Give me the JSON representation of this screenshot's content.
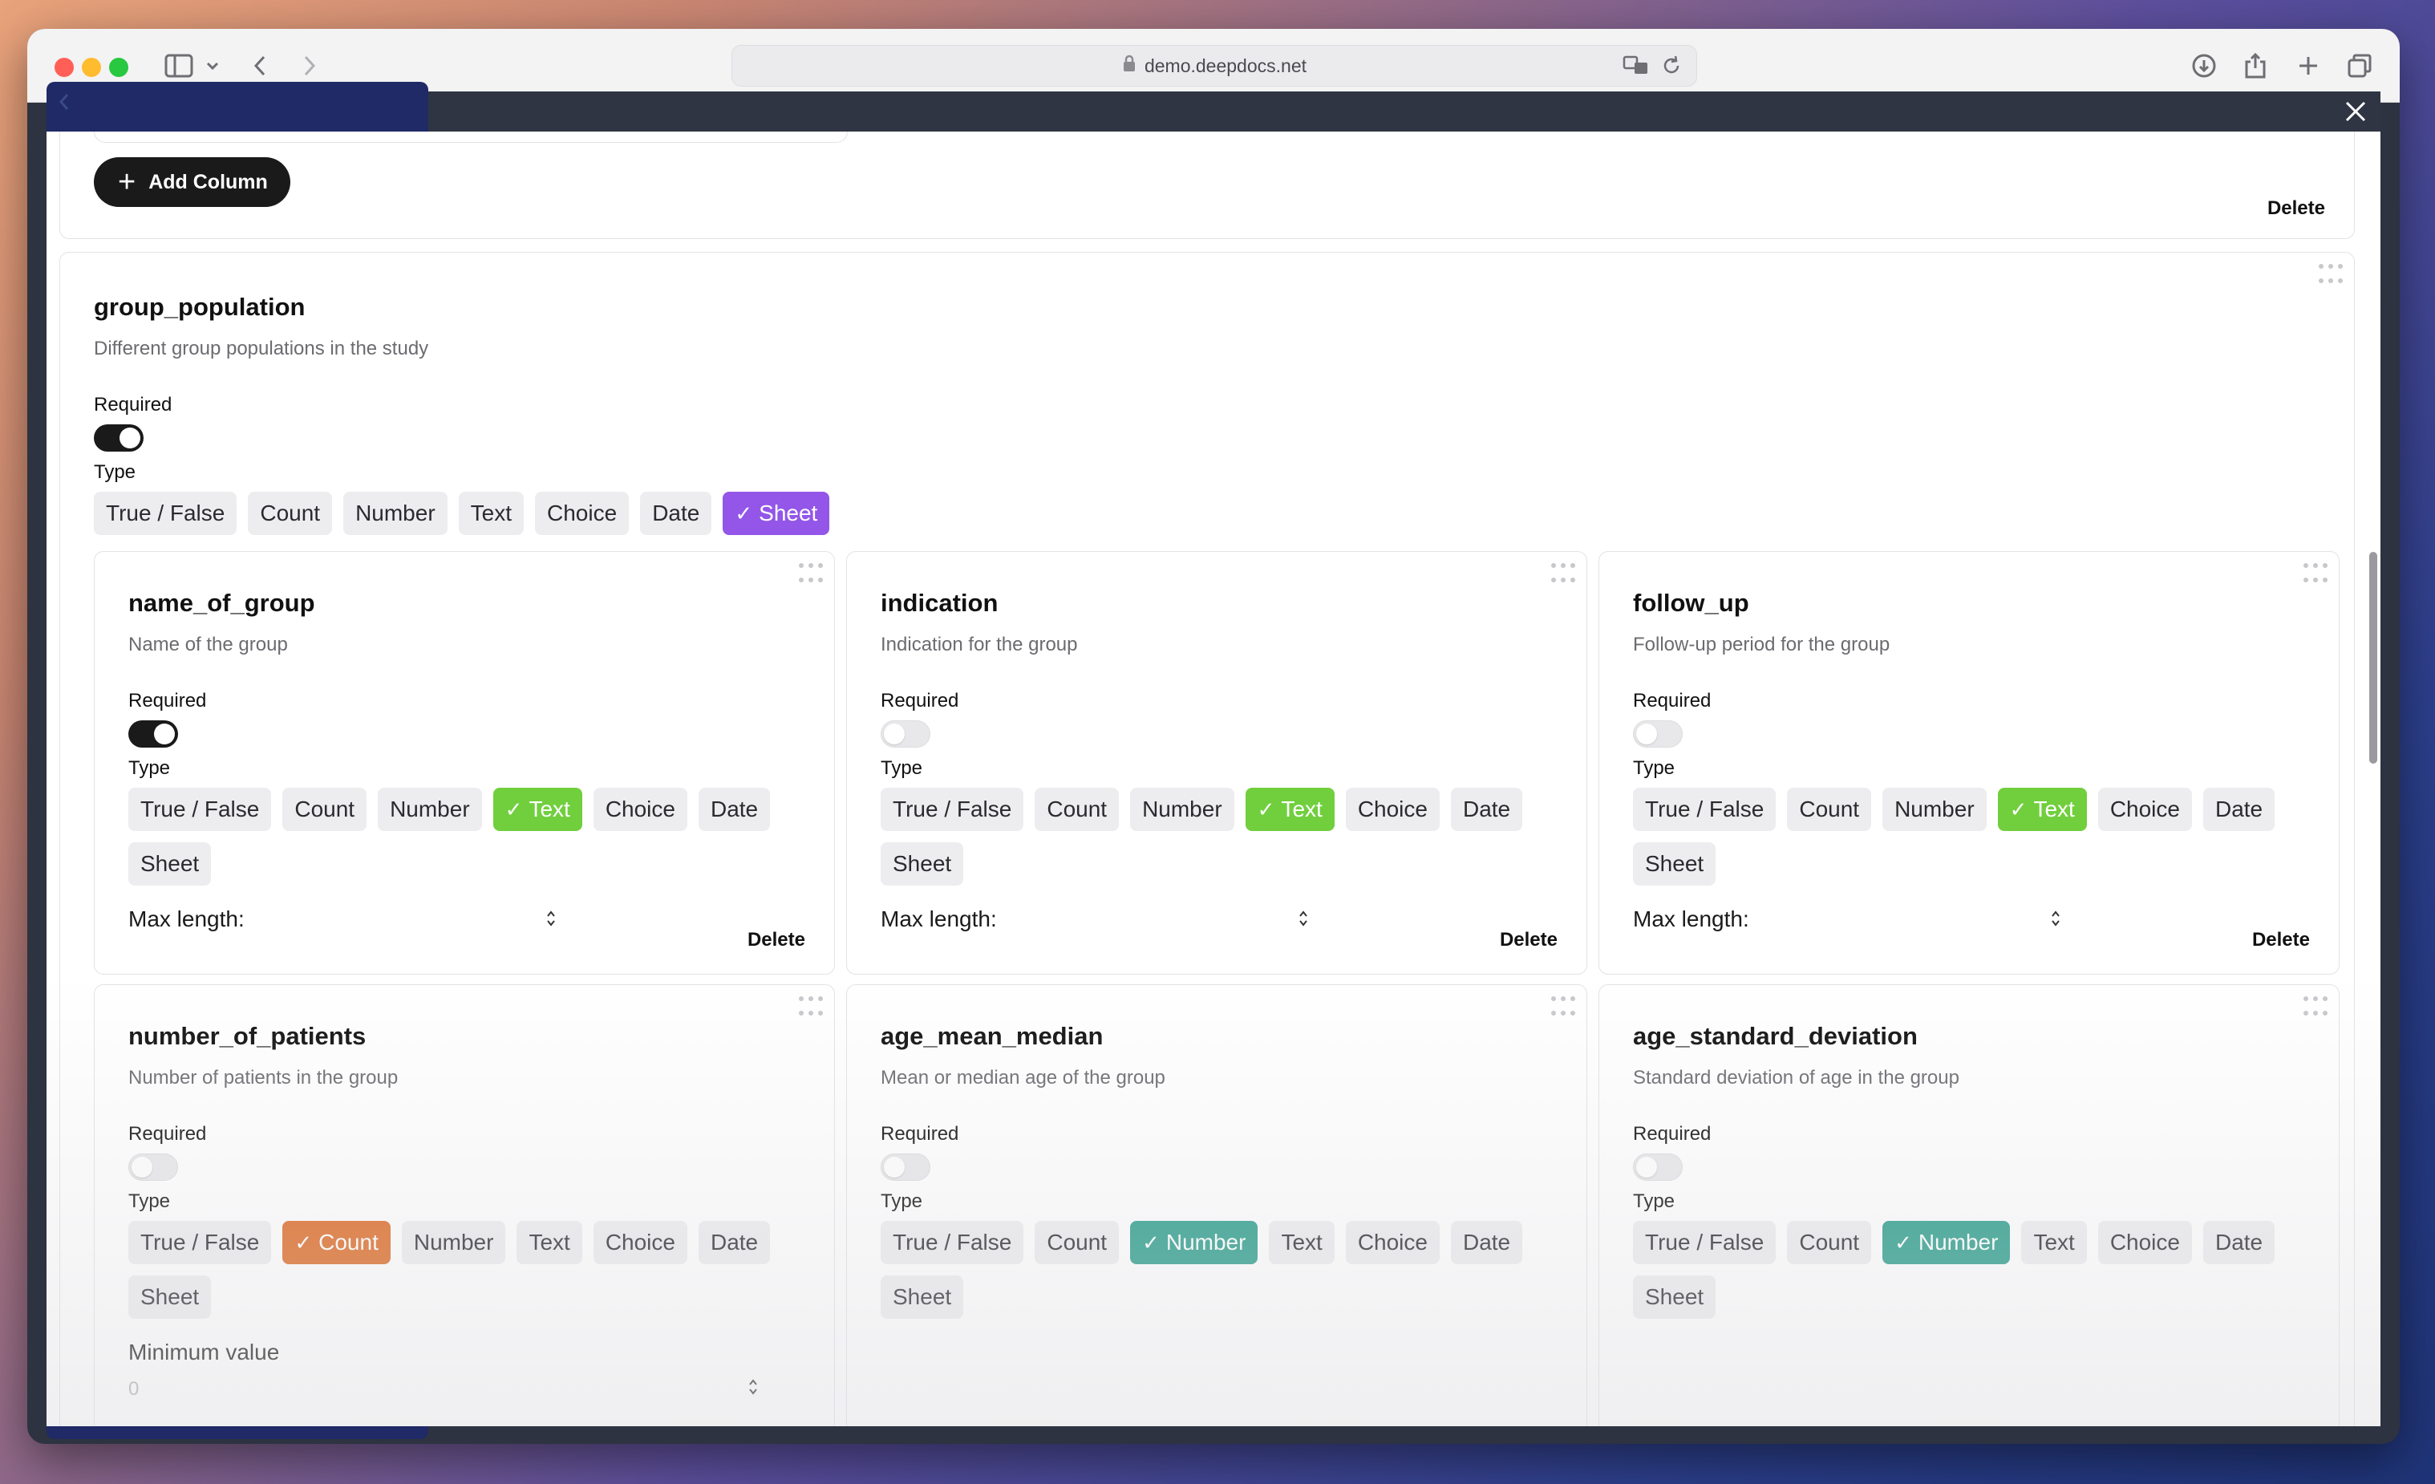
{
  "browser": {
    "url": "demo.deepdocs.net"
  },
  "toolbar": {
    "add_column_label": "Add Column",
    "top_delete_label": "Delete"
  },
  "group": {
    "title": "group_population",
    "description": "Different group populations in the study",
    "required_label": "Required",
    "required_on": true,
    "type_label": "Type",
    "types": [
      "True / False",
      "Count",
      "Number",
      "Text",
      "Choice",
      "Date",
      "Sheet"
    ],
    "selected_type": "Sheet"
  },
  "fields": [
    {
      "title": "name_of_group",
      "description": "Name of the group",
      "required_label": "Required",
      "required_on": true,
      "type_label": "Type",
      "types": [
        "True / False",
        "Count",
        "Number",
        "Text",
        "Choice",
        "Date",
        "Sheet"
      ],
      "selected_type": "Text",
      "extra_label": "Max length:",
      "delete_label": "Delete"
    },
    {
      "title": "indication",
      "description": "Indication for the group",
      "required_label": "Required",
      "required_on": false,
      "type_label": "Type",
      "types": [
        "True / False",
        "Count",
        "Number",
        "Text",
        "Choice",
        "Date",
        "Sheet"
      ],
      "selected_type": "Text",
      "extra_label": "Max length:",
      "delete_label": "Delete"
    },
    {
      "title": "follow_up",
      "description": "Follow-up period for the group",
      "required_label": "Required",
      "required_on": false,
      "type_label": "Type",
      "types": [
        "True / False",
        "Count",
        "Number",
        "Text",
        "Choice",
        "Date",
        "Sheet"
      ],
      "selected_type": "Text",
      "extra_label": "Max length:",
      "delete_label": "Delete"
    },
    {
      "title": "number_of_patients",
      "description": "Number of patients in the group",
      "required_label": "Required",
      "required_on": false,
      "type_label": "Type",
      "types": [
        "True / False",
        "Count",
        "Number",
        "Text",
        "Choice",
        "Date",
        "Sheet"
      ],
      "selected_type": "Count",
      "extra_label": "Minimum value",
      "extra_value": "0"
    },
    {
      "title": "age_mean_median",
      "description": "Mean or median age of the group",
      "required_label": "Required",
      "required_on": false,
      "type_label": "Type",
      "types": [
        "True / False",
        "Count",
        "Number",
        "Text",
        "Choice",
        "Date",
        "Sheet"
      ],
      "selected_type": "Number"
    },
    {
      "title": "age_standard_deviation",
      "description": "Standard deviation of age in the group",
      "required_label": "Required",
      "required_on": false,
      "type_label": "Type",
      "types": [
        "True / False",
        "Count",
        "Number",
        "Text",
        "Choice",
        "Date",
        "Sheet"
      ],
      "selected_type": "Number"
    }
  ],
  "colors": {
    "sheet_selected": "#9356e8",
    "text_selected": "#71cf3e",
    "count_selected": "#dd6a24",
    "number_selected": "#2a9d8a"
  }
}
